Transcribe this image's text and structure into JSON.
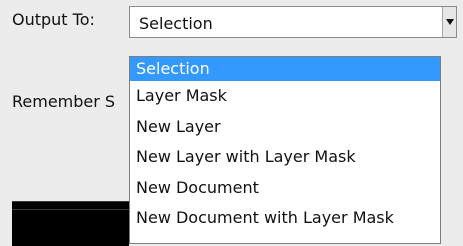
{
  "output_to_label": "Output To:",
  "select": {
    "current_value": "Selection"
  },
  "remember_label": "Remember S",
  "dropdown": {
    "options": [
      {
        "label": "Selection",
        "selected": true
      },
      {
        "label": "Layer Mask",
        "selected": false
      },
      {
        "label": "New Layer",
        "selected": false
      },
      {
        "label": "New Layer with Layer Mask",
        "selected": false
      },
      {
        "label": "New Document",
        "selected": false
      },
      {
        "label": "New Document with Layer Mask",
        "selected": false
      }
    ]
  },
  "colors": {
    "background": "#ececec",
    "selection": "#3399ff",
    "text": "#111111",
    "menu_bg": "#ffffff"
  }
}
